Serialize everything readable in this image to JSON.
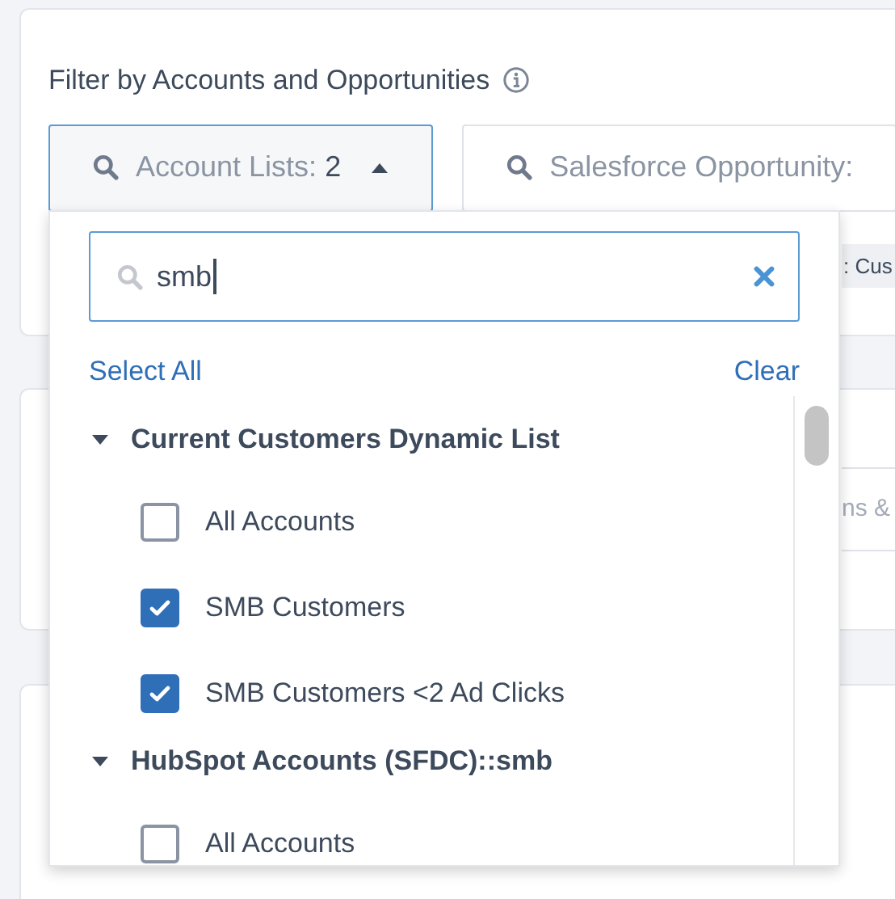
{
  "filter": {
    "title": "Filter by Accounts and Opportunities",
    "buttons": [
      {
        "label": "Account Lists:",
        "count": "2",
        "expanded": true
      },
      {
        "label": "Salesforce Opportunity:",
        "expanded": false
      }
    ]
  },
  "background": {
    "chip": ": Cus",
    "field_text": "ns &"
  },
  "dropdown": {
    "search": {
      "value": "smb"
    },
    "select_all": "Select All",
    "clear": "Clear",
    "groups": [
      {
        "name": "Current Customers Dynamic List",
        "expanded": true,
        "items": [
          {
            "label": "All Accounts",
            "checked": false
          },
          {
            "label": "SMB Customers",
            "checked": true
          },
          {
            "label": "SMB Customers <2 Ad Clicks",
            "checked": true
          }
        ]
      },
      {
        "name": "HubSpot Accounts (SFDC)::smb",
        "expanded": true,
        "items": [
          {
            "label": "All Accounts",
            "checked": false
          }
        ]
      }
    ]
  }
}
